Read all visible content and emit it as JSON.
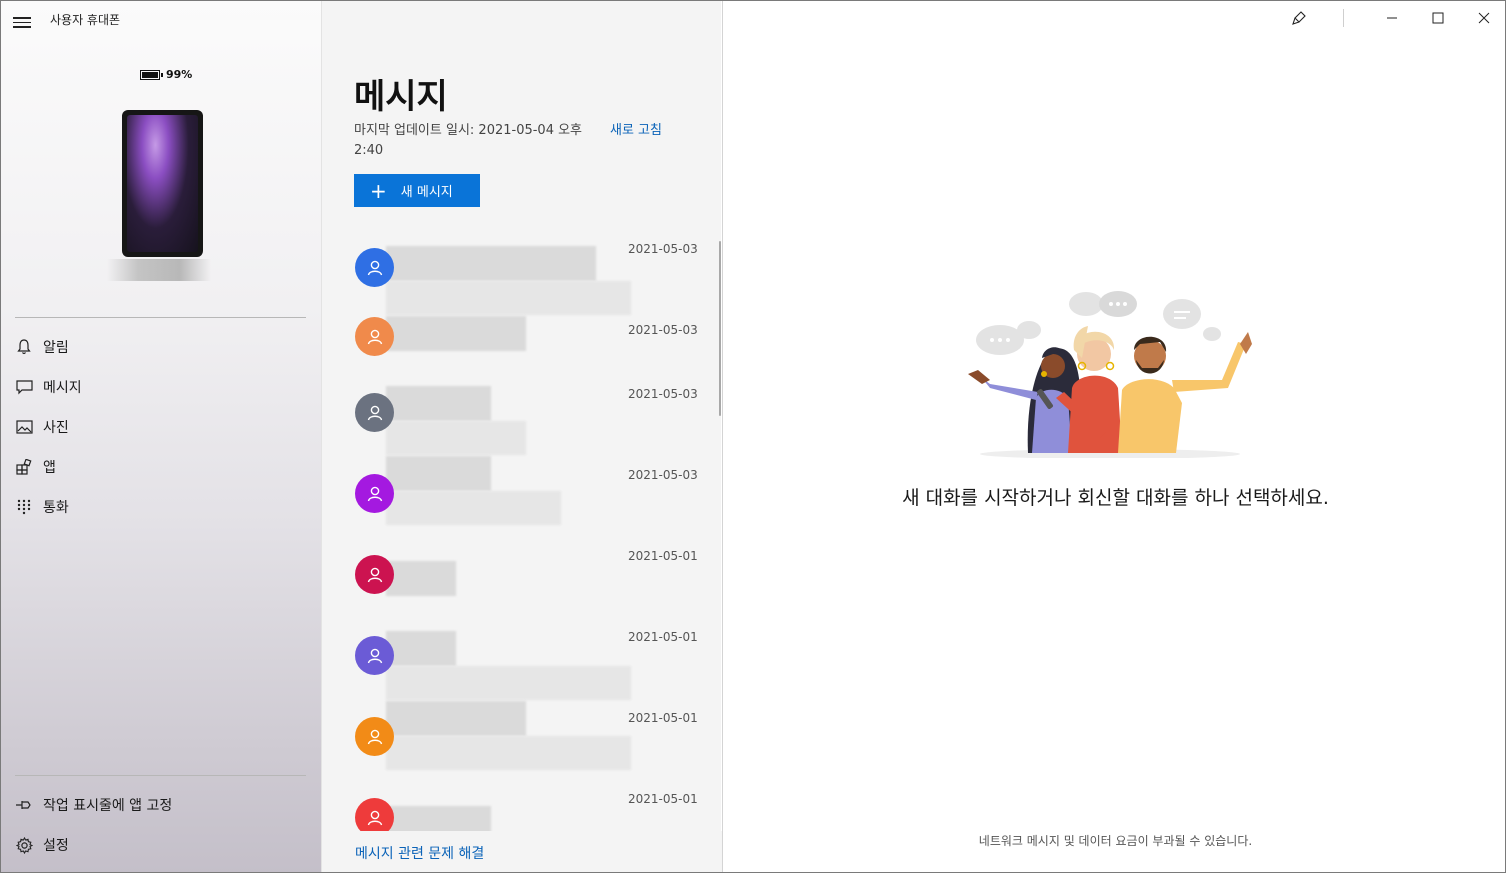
{
  "window": {
    "app_title": "사용자 휴대폰",
    "controls": [
      "brush-icon",
      "minimize-icon",
      "maximize-icon",
      "close-icon"
    ]
  },
  "sidebar": {
    "battery": "99%",
    "items": [
      {
        "label": "알림",
        "icon": "bell-icon"
      },
      {
        "label": "메시지",
        "icon": "chat-icon"
      },
      {
        "label": "사진",
        "icon": "photo-icon"
      },
      {
        "label": "앱",
        "icon": "apps-icon"
      },
      {
        "label": "통화",
        "icon": "dialpad-icon"
      }
    ],
    "bottom_items": [
      {
        "label": "작업 표시줄에 앱 고정",
        "icon": "pin-icon"
      },
      {
        "label": "설정",
        "icon": "gear-icon"
      }
    ]
  },
  "list": {
    "title": "메시지",
    "updated": "마지막 업데이트 일시: 2021-05-04 오후 2:40",
    "refresh": "새로 고침",
    "new_message": "새 메시지",
    "conversations": [
      {
        "date": "2021-05-03",
        "avatar_color": "#2f6fe4"
      },
      {
        "date": "2021-05-03",
        "avatar_color": "#f08a4b"
      },
      {
        "date": "2021-05-03",
        "avatar_color": "#6b7280"
      },
      {
        "date": "2021-05-03",
        "avatar_color": "#a419e0"
      },
      {
        "date": "2021-05-01",
        "avatar_color": "#cc1350"
      },
      {
        "date": "2021-05-01",
        "avatar_color": "#6b5bd6"
      },
      {
        "date": "2021-05-01",
        "avatar_color": "#f28b17"
      },
      {
        "date": "2021-05-01",
        "avatar_color": "#ee3b3b"
      }
    ],
    "troubleshoot": "메시지 관련 문제 해결"
  },
  "main": {
    "empty_message": "새 대화를 시작하거나 회신할 대화를 하나 선택하세요.",
    "footer_note": "네트워크 메시지 및 데이터 요금이 부과될 수 있습니다."
  },
  "colors": {
    "accent": "#0a74d8",
    "link": "#0b63b8"
  }
}
